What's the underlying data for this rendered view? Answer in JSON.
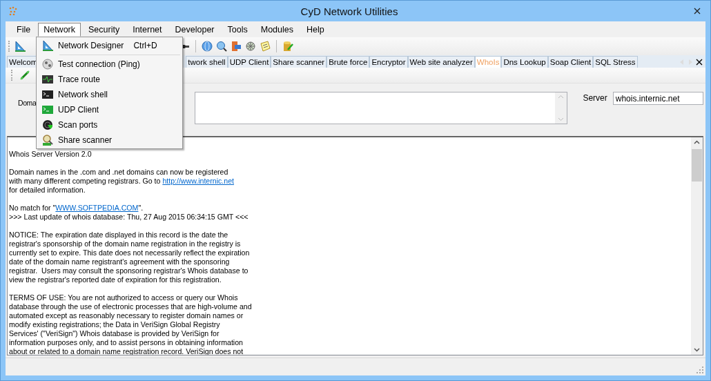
{
  "window": {
    "title": "CyD Network Utilities"
  },
  "menu": [
    {
      "label": "File",
      "selected": false
    },
    {
      "label": "Network",
      "selected": true
    },
    {
      "label": "Security",
      "selected": false
    },
    {
      "label": "Internet",
      "selected": false
    },
    {
      "label": "Developer",
      "selected": false
    },
    {
      "label": "Tools",
      "selected": false
    },
    {
      "label": "Modules",
      "selected": false
    },
    {
      "label": "Help",
      "selected": false
    }
  ],
  "dropdown": [
    {
      "label": "Network Designer",
      "shortcut": "Ctrl+D",
      "kind": "ruler"
    },
    {
      "kind": "separator"
    },
    {
      "label": "Test connection (Ping)",
      "kind": "ball"
    },
    {
      "label": "Trace route",
      "kind": "trace"
    },
    {
      "label": "Network shell",
      "kind": "shell"
    },
    {
      "label": "UDP Client",
      "kind": "udp"
    },
    {
      "label": "Scan ports",
      "kind": "radar"
    },
    {
      "label": "Share scanner",
      "kind": "share"
    }
  ],
  "tabs": [
    {
      "label": "Welcom",
      "selected": false
    },
    {
      "label": "twork shell",
      "selected": false
    },
    {
      "label": "UDP Client",
      "selected": false
    },
    {
      "label": "Share scanner",
      "selected": false
    },
    {
      "label": "Brute force",
      "selected": false
    },
    {
      "label": "Encryptor",
      "selected": false
    },
    {
      "label": "Web site analyzer",
      "selected": false
    },
    {
      "label": "WhoIs",
      "selected": true
    },
    {
      "label": "Dns Lookup",
      "selected": false
    },
    {
      "label": "Soap Client",
      "selected": false
    },
    {
      "label": "SQL Stress",
      "selected": false
    }
  ],
  "domain": {
    "label": "Doma"
  },
  "server": {
    "label": "Server",
    "value": "whois.internic.net"
  },
  "output": [
    [
      [
        {
          "kind": "text",
          "text": "Whois Server Version 2.0"
        }
      ]
    ],
    [
      [
        {
          "kind": "text",
          "text": "Domain names in the .com and .net domains can now be registered"
        }
      ],
      [
        {
          "kind": "text",
          "text": "with many different competing registrars. Go to "
        },
        {
          "kind": "link",
          "text": "http://www.internic.net"
        }
      ],
      [
        {
          "kind": "text",
          "text": "for detailed information."
        }
      ]
    ],
    [
      [
        {
          "kind": "text",
          "text": "No match for \""
        },
        {
          "kind": "link",
          "text": "WWW.SOFTPEDIA.COM"
        },
        {
          "kind": "text",
          "text": "\"."
        }
      ],
      [
        {
          "kind": "text",
          "text": ">>> Last update of whois database: Thu, 27 Aug 2015 06:34:15 GMT <<<"
        }
      ]
    ],
    [
      [
        {
          "kind": "text",
          "text": "NOTICE: The expiration date displayed in this record is the date the"
        }
      ],
      [
        {
          "kind": "text",
          "text": "registrar's sponsorship of the domain name registration in the registry is"
        }
      ],
      [
        {
          "kind": "text",
          "text": "currently set to expire. This date does not necessarily reflect the expiration"
        }
      ],
      [
        {
          "kind": "text",
          "text": "date of the domain name registrant's agreement with the sponsoring"
        }
      ],
      [
        {
          "kind": "text",
          "text": "registrar.  Users may consult the sponsoring registrar's Whois database to"
        }
      ],
      [
        {
          "kind": "text",
          "text": "view the registrar's reported date of expiration for this registration."
        }
      ]
    ],
    [
      [
        {
          "kind": "text",
          "text": "TERMS OF USE: You are not authorized to access or query our Whois"
        }
      ],
      [
        {
          "kind": "text",
          "text": "database through the use of electronic processes that are high-volume and"
        }
      ],
      [
        {
          "kind": "text",
          "text": "automated except as reasonably necessary to register domain names or"
        }
      ],
      [
        {
          "kind": "text",
          "text": "modify existing registrations; the Data in VeriSign Global Registry"
        }
      ],
      [
        {
          "kind": "text",
          "text": "Services' (\"VeriSign\") Whois database is provided by VeriSign for"
        }
      ],
      [
        {
          "kind": "text",
          "text": "information purposes only, and to assist persons in obtaining information"
        }
      ],
      [
        {
          "kind": "text",
          "text": "about or related to a domain name registration record. VeriSign does not"
        }
      ]
    ]
  ]
}
